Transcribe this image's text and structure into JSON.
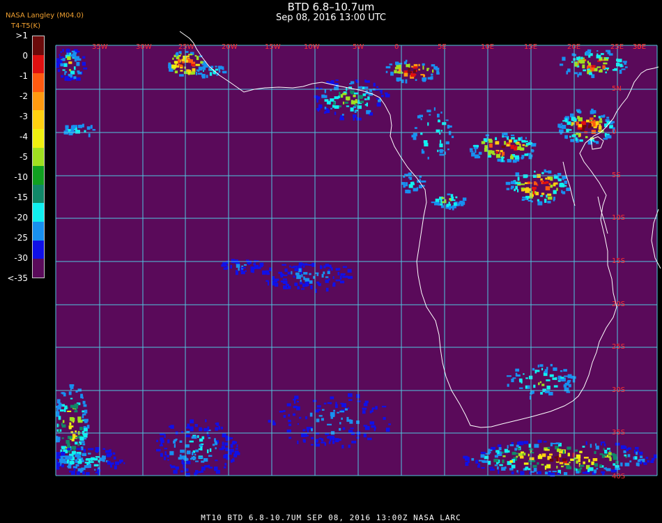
{
  "header": {
    "title": "BTD 6.8–10.7um",
    "subtitle": "Sep 08, 2016 13:00 UTC",
    "credit_line1": "NASA Langley (M04.0)",
    "credit_line2": "T4-T5(K)"
  },
  "colorbar": {
    "labels": [
      ">1",
      "0",
      "-1",
      "-2",
      "-3",
      "-4",
      "-5",
      "-10",
      "-15",
      "-20",
      "-25",
      "-30",
      "<-35"
    ],
    "colors": [
      "#6b0a0a",
      "#e01010",
      "#ff5a10",
      "#ff9a10",
      "#ffd010",
      "#f0f010",
      "#a0e020",
      "#10a020",
      "#108868",
      "#10f0f0",
      "#1890f0",
      "#1010e8",
      "#5a0a5a"
    ]
  },
  "map": {
    "background_color": "#5a0a5a",
    "grid_color": "#50c8e0",
    "coast_color": "#ffffff",
    "lon_labels": [
      "35W",
      "30W",
      "25W",
      "20W",
      "15W",
      "10W",
      "5W",
      "0",
      "5E",
      "10E",
      "15E",
      "20E",
      "25E",
      "30E",
      "35E"
    ],
    "lat_labels": [
      "5N",
      "0",
      "5S",
      "10S",
      "15S",
      "20S",
      "25S",
      "30S",
      "35S",
      "40S"
    ]
  },
  "footer": {
    "text": "MT10  BTD 6.8-10.7UM   SEP 08, 2016 13:00Z   NASA LARC"
  }
}
